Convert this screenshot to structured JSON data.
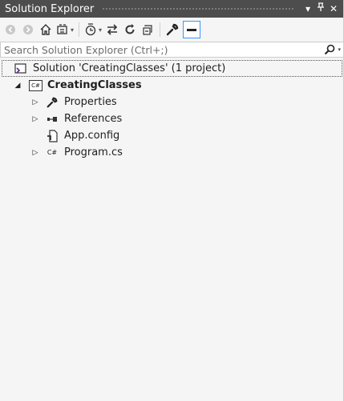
{
  "window": {
    "title": "Solution Explorer"
  },
  "title_controls": {
    "dropdown": "▾",
    "pin": "ᛃ",
    "close": "✕"
  },
  "search": {
    "placeholder": "Search Solution Explorer (Ctrl+;)"
  },
  "tree": {
    "solution": {
      "label": "Solution 'CreatingClasses' (1 project)"
    },
    "project": {
      "label": "CreatingClasses",
      "icon_text": "C#"
    },
    "items": [
      {
        "label": "Properties",
        "icon": "wrench-icon"
      },
      {
        "label": "References",
        "icon": "references-icon"
      },
      {
        "label": "App.config",
        "icon": "config-file-icon"
      },
      {
        "label": "Program.cs",
        "icon": "csharp-file-icon",
        "icon_text": "C#"
      }
    ]
  },
  "colors": {
    "titlebar": "#4d4d4d",
    "panel": "#f5f5f5",
    "accent": "#3399ff"
  }
}
